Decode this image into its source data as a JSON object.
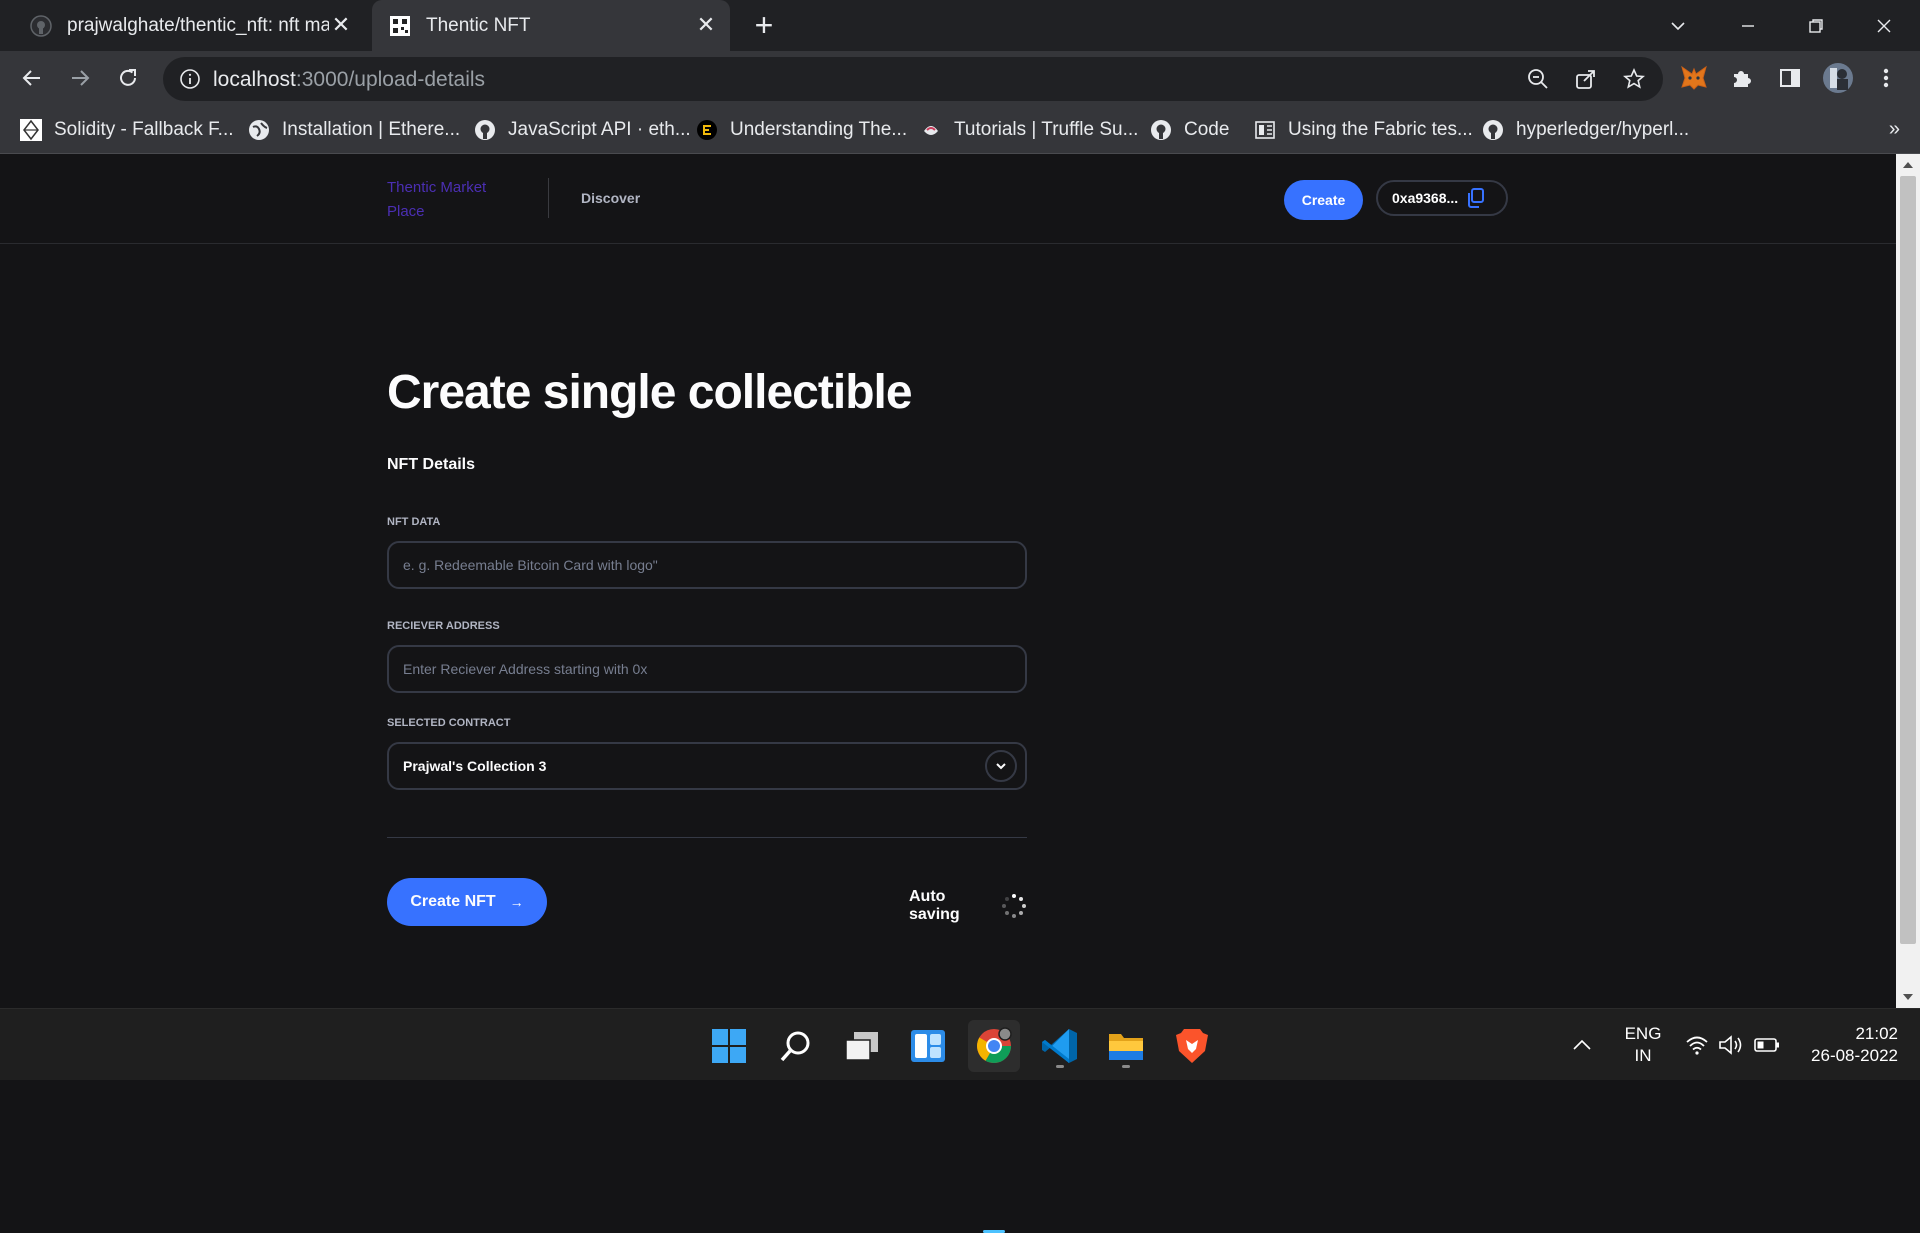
{
  "browser": {
    "tabs": [
      {
        "title": "prajwalghate/thentic_nft: nft mar",
        "icon": "github-icon",
        "active": false
      },
      {
        "title": "Thentic NFT",
        "icon": "thentic-favicon-icon",
        "active": true
      }
    ],
    "new_tab_icon": "plus-icon",
    "address": {
      "host": "localhost",
      "path": ":3000/upload-details"
    },
    "bookmarks": [
      {
        "label": "Solidity - Fallback F...",
        "icon": "solidity-icon"
      },
      {
        "label": "Installation | Ethere...",
        "icon": "globe-icon"
      },
      {
        "label": "JavaScript API · eth...",
        "icon": "github-icon"
      },
      {
        "label": "Understanding The...",
        "icon": "yellow-e-icon"
      },
      {
        "label": "Tutorials | Truffle Su...",
        "icon": "truffle-icon"
      },
      {
        "label": "Code",
        "icon": "github-icon"
      },
      {
        "label": "Using the Fabric tes...",
        "icon": "document-icon"
      },
      {
        "label": "hyperledger/hyperl...",
        "icon": "github-icon"
      }
    ],
    "bookmarks_overflow": "»"
  },
  "site": {
    "logo": "Thentic Market Place",
    "nav_discover": "Discover",
    "create_button": "Create",
    "wallet_address": "0xa9368..."
  },
  "form": {
    "title": "Create single collectible",
    "section": "NFT Details",
    "nft_data": {
      "label": "NFT DATA",
      "placeholder": "e. g. Redeemable Bitcoin Card with logo\""
    },
    "receiver": {
      "label": "RECIEVER ADDRESS",
      "placeholder": "Enter Reciever Address starting with 0x"
    },
    "contract": {
      "label": "SELECTED CONTRACT",
      "value": "Prajwal's Collection 3"
    },
    "submit": "Create NFT",
    "submit_arrow": "→",
    "autosave": "Auto saving"
  },
  "taskbar": {
    "apps": [
      "windows-start-icon",
      "search-icon",
      "task-view-icon",
      "widgets-icon",
      "chrome-icon",
      "vscode-icon",
      "file-explorer-icon",
      "brave-icon"
    ],
    "lang_line1": "ENG",
    "lang_line2": "IN",
    "time": "21:02",
    "date": "26-08-2022"
  },
  "colors": {
    "accent": "#3772ff",
    "page_bg": "#141416",
    "logo": "#4b2fb3"
  }
}
